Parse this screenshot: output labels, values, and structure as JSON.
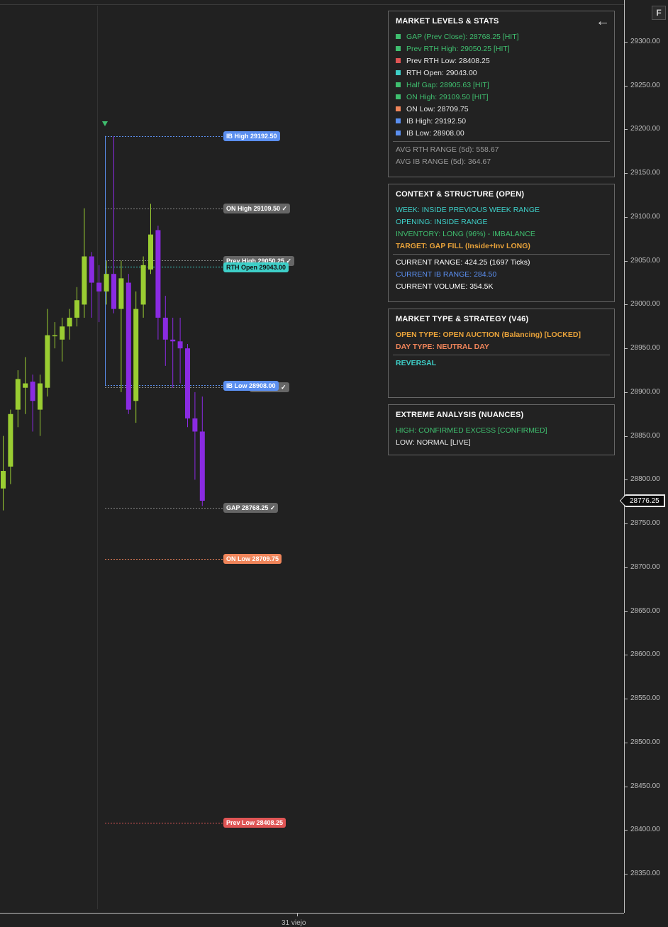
{
  "right_axis": {
    "ticks": [
      "29300.00",
      "29250.00",
      "29200.00",
      "29150.00",
      "29100.00",
      "29050.00",
      "29000.00",
      "28950.00",
      "28900.00",
      "28850.00",
      "28800.00",
      "28750.00",
      "28700.00",
      "28650.00",
      "28600.00",
      "28550.00",
      "28500.00",
      "28450.00",
      "28400.00",
      "28350.00"
    ],
    "current_price": "28776.25",
    "f_button": "F"
  },
  "bottom_axis": {
    "time_label": "31 viejo"
  },
  "levels": {
    "ib_high": "IB High 29192.50",
    "on_high": "ON High 29109.50 ✓",
    "prev_high": "Prev High 29050.25 ✓",
    "rth_open": "RTH Open 29043.00",
    "ib_low": "IB Low 28908.00",
    "half_gap": "28905.63 ✓",
    "gap": "GAP 28768.25 ✓",
    "on_low": "ON Low 28709.75",
    "prev_low": "Prev Low 28408.25"
  },
  "panels": {
    "levels_stats": {
      "title": "MARKET LEVELS & STATS",
      "items": [
        {
          "text": "GAP (Prev Close): 28768.25 [HIT]",
          "color": "#3fbf6f",
          "text_color": "#3fbf6f"
        },
        {
          "text": "Prev RTH High: 29050.25 [HIT]",
          "color": "#3fbf6f",
          "text_color": "#3fbf6f"
        },
        {
          "text": "Prev RTH Low: 28408.25",
          "color": "#e05555",
          "text_color": "#e6e6e6"
        },
        {
          "text": "RTH Open: 29043.00",
          "color": "#3ecfc8",
          "text_color": "#e6e6e6"
        },
        {
          "text": "Half Gap: 28905.63 [HIT]",
          "color": "#3fbf6f",
          "text_color": "#3fbf6f"
        },
        {
          "text": "ON High: 29109.50 [HIT]",
          "color": "#3fbf6f",
          "text_color": "#3fbf6f"
        },
        {
          "text": "ON Low: 28709.75",
          "color": "#f0855a",
          "text_color": "#e6e6e6"
        },
        {
          "text": "IB High: 29192.50",
          "color": "#5b8ff0",
          "text_color": "#e6e6e6"
        },
        {
          "text": "IB Low: 28908.00",
          "color": "#5b8ff0",
          "text_color": "#e6e6e6"
        }
      ],
      "avg_rth": "AVG RTH RANGE (5d): 558.67",
      "avg_ib": "AVG IB RANGE (5d): 364.67"
    },
    "context": {
      "title": "CONTEXT & STRUCTURE (OPEN)",
      "week": "WEEK: INSIDE PREVIOUS WEEK RANGE",
      "opening": "OPENING: INSIDE RANGE",
      "inventory": "INVENTORY: LONG (96%) - IMBALANCE",
      "target": "TARGET: GAP FILL (Inside+Inv LONG)",
      "current_range": "CURRENT RANGE: 424.25 (1697 Ticks)",
      "current_ib": "CURRENT IB RANGE: 284.50",
      "current_volume": "CURRENT VOLUME: 354.5K"
    },
    "market_type": {
      "title": "MARKET TYPE & STRATEGY (V46)",
      "open_type": "OPEN TYPE: OPEN AUCTION (Balancing) [LOCKED]",
      "day_type": "DAY TYPE: NEUTRAL DAY",
      "strategy": "REVERSAL"
    },
    "extreme": {
      "title": "EXTREME ANALYSIS (NUANCES)",
      "high": "HIGH: CONFIRMED EXCESS [CONFIRMED]",
      "low": "LOW: NORMAL [LIVE]"
    }
  },
  "colors": {
    "bull": "#9acd32",
    "bear": "#8a2be2",
    "ib": "#5b8ff0",
    "on_high": "#666666",
    "rth_open": "#3ecfc8",
    "on_low": "#f0855a",
    "prev_low": "#e05555",
    "gap": "#666666"
  },
  "candles": [
    {
      "o": 28790,
      "h": 28850,
      "l": 28765,
      "c": 28810
    },
    {
      "o": 28815,
      "h": 28880,
      "l": 28795,
      "c": 28875
    },
    {
      "o": 28880,
      "h": 28925,
      "l": 28860,
      "c": 28915
    },
    {
      "o": 28905,
      "h": 28940,
      "l": 28875,
      "c": 28910
    },
    {
      "o": 28912,
      "h": 28920,
      "l": 28855,
      "c": 28890
    },
    {
      "o": 28880,
      "h": 28920,
      "l": 28850,
      "c": 28910
    },
    {
      "o": 28905,
      "h": 28995,
      "l": 28895,
      "c": 28965
    },
    {
      "o": 28965,
      "h": 28980,
      "l": 28950,
      "c": 28965
    },
    {
      "o": 28960,
      "h": 28985,
      "l": 28935,
      "c": 28975
    },
    {
      "o": 28975,
      "h": 28995,
      "l": 28960,
      "c": 28985
    },
    {
      "o": 28985,
      "h": 29020,
      "l": 28975,
      "c": 29005
    },
    {
      "o": 29000,
      "h": 29110,
      "l": 28985,
      "c": 29055
    },
    {
      "o": 29055,
      "h": 29060,
      "l": 28985,
      "c": 29025
    },
    {
      "o": 29025,
      "h": 29045,
      "l": 28980,
      "c": 29015
    },
    {
      "o": 29015,
      "h": 29050,
      "l": 29000,
      "c": 29035
    },
    {
      "o": 29035,
      "h": 29192,
      "l": 28990,
      "c": 28995
    },
    {
      "o": 28995,
      "h": 29050,
      "l": 28900,
      "c": 29030
    },
    {
      "o": 29025,
      "h": 29035,
      "l": 28875,
      "c": 28880
    },
    {
      "o": 28890,
      "h": 29015,
      "l": 28865,
      "c": 28995
    },
    {
      "o": 29000,
      "h": 29055,
      "l": 28985,
      "c": 29045
    },
    {
      "o": 29040,
      "h": 29115,
      "l": 29035,
      "c": 29080
    },
    {
      "o": 29085,
      "h": 29090,
      "l": 28960,
      "c": 28985
    },
    {
      "o": 28985,
      "h": 29010,
      "l": 28930,
      "c": 28960
    },
    {
      "o": 28960,
      "h": 28985,
      "l": 28905,
      "c": 28958
    },
    {
      "o": 28958,
      "h": 28985,
      "l": 28910,
      "c": 28950
    },
    {
      "o": 28950,
      "h": 28955,
      "l": 28860,
      "c": 28870
    },
    {
      "o": 28870,
      "h": 28900,
      "l": 28800,
      "c": 28855
    },
    {
      "o": 28855,
      "h": 28895,
      "l": 28770,
      "c": 28776
    }
  ]
}
